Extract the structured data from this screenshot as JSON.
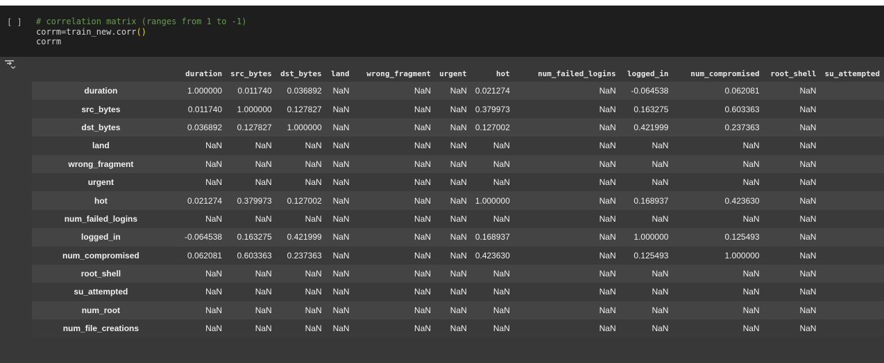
{
  "cell": {
    "run_bracket": "[ ]",
    "code": {
      "line1": "# correlation matrix (ranges from 1 to -1)",
      "line2_prefix": "corrm=train_new.corr",
      "line2_parens": "()",
      "line3": "corrm"
    }
  },
  "output": {
    "icon": "output-toggle-icon",
    "columns": [
      "",
      "duration",
      "src_bytes",
      "dst_bytes",
      "land",
      "wrong_fragment",
      "urgent",
      "hot",
      "num_failed_logins",
      "logged_in",
      "num_compromised",
      "root_shell",
      "su_attempted"
    ],
    "rows": [
      {
        "label": "duration",
        "cells": [
          "1.000000",
          "0.011740",
          "0.036892",
          "NaN",
          "NaN",
          "NaN",
          "0.021274",
          "NaN",
          "-0.064538",
          "0.062081",
          "NaN",
          ""
        ]
      },
      {
        "label": "src_bytes",
        "cells": [
          "0.011740",
          "1.000000",
          "0.127827",
          "NaN",
          "NaN",
          "NaN",
          "0.379973",
          "NaN",
          "0.163275",
          "0.603363",
          "NaN",
          ""
        ]
      },
      {
        "label": "dst_bytes",
        "cells": [
          "0.036892",
          "0.127827",
          "1.000000",
          "NaN",
          "NaN",
          "NaN",
          "0.127002",
          "NaN",
          "0.421999",
          "0.237363",
          "NaN",
          ""
        ]
      },
      {
        "label": "land",
        "cells": [
          "NaN",
          "NaN",
          "NaN",
          "NaN",
          "NaN",
          "NaN",
          "NaN",
          "NaN",
          "NaN",
          "NaN",
          "NaN",
          ""
        ]
      },
      {
        "label": "wrong_fragment",
        "cells": [
          "NaN",
          "NaN",
          "NaN",
          "NaN",
          "NaN",
          "NaN",
          "NaN",
          "NaN",
          "NaN",
          "NaN",
          "NaN",
          ""
        ]
      },
      {
        "label": "urgent",
        "cells": [
          "NaN",
          "NaN",
          "NaN",
          "NaN",
          "NaN",
          "NaN",
          "NaN",
          "NaN",
          "NaN",
          "NaN",
          "NaN",
          ""
        ]
      },
      {
        "label": "hot",
        "cells": [
          "0.021274",
          "0.379973",
          "0.127002",
          "NaN",
          "NaN",
          "NaN",
          "1.000000",
          "NaN",
          "0.168937",
          "0.423630",
          "NaN",
          ""
        ]
      },
      {
        "label": "num_failed_logins",
        "cells": [
          "NaN",
          "NaN",
          "NaN",
          "NaN",
          "NaN",
          "NaN",
          "NaN",
          "NaN",
          "NaN",
          "NaN",
          "NaN",
          ""
        ]
      },
      {
        "label": "logged_in",
        "cells": [
          "-0.064538",
          "0.163275",
          "0.421999",
          "NaN",
          "NaN",
          "NaN",
          "0.168937",
          "NaN",
          "1.000000",
          "0.125493",
          "NaN",
          ""
        ]
      },
      {
        "label": "num_compromised",
        "cells": [
          "0.062081",
          "0.603363",
          "0.237363",
          "NaN",
          "NaN",
          "NaN",
          "0.423630",
          "NaN",
          "0.125493",
          "1.000000",
          "NaN",
          ""
        ]
      },
      {
        "label": "root_shell",
        "cells": [
          "NaN",
          "NaN",
          "NaN",
          "NaN",
          "NaN",
          "NaN",
          "NaN",
          "NaN",
          "NaN",
          "NaN",
          "NaN",
          ""
        ]
      },
      {
        "label": "su_attempted",
        "cells": [
          "NaN",
          "NaN",
          "NaN",
          "NaN",
          "NaN",
          "NaN",
          "NaN",
          "NaN",
          "NaN",
          "NaN",
          "NaN",
          ""
        ]
      },
      {
        "label": "num_root",
        "cells": [
          "NaN",
          "NaN",
          "NaN",
          "NaN",
          "NaN",
          "NaN",
          "NaN",
          "NaN",
          "NaN",
          "NaN",
          "NaN",
          ""
        ]
      },
      {
        "label": "num_file_creations",
        "cells": [
          "NaN",
          "NaN",
          "NaN",
          "NaN",
          "NaN",
          "NaN",
          "NaN",
          "NaN",
          "NaN",
          "NaN",
          "NaN",
          ""
        ]
      }
    ]
  },
  "colors": {
    "cell_bg": "#1e1e1e",
    "output_bg": "#383838",
    "comment": "#6a9955",
    "paren": "#ffd700"
  }
}
